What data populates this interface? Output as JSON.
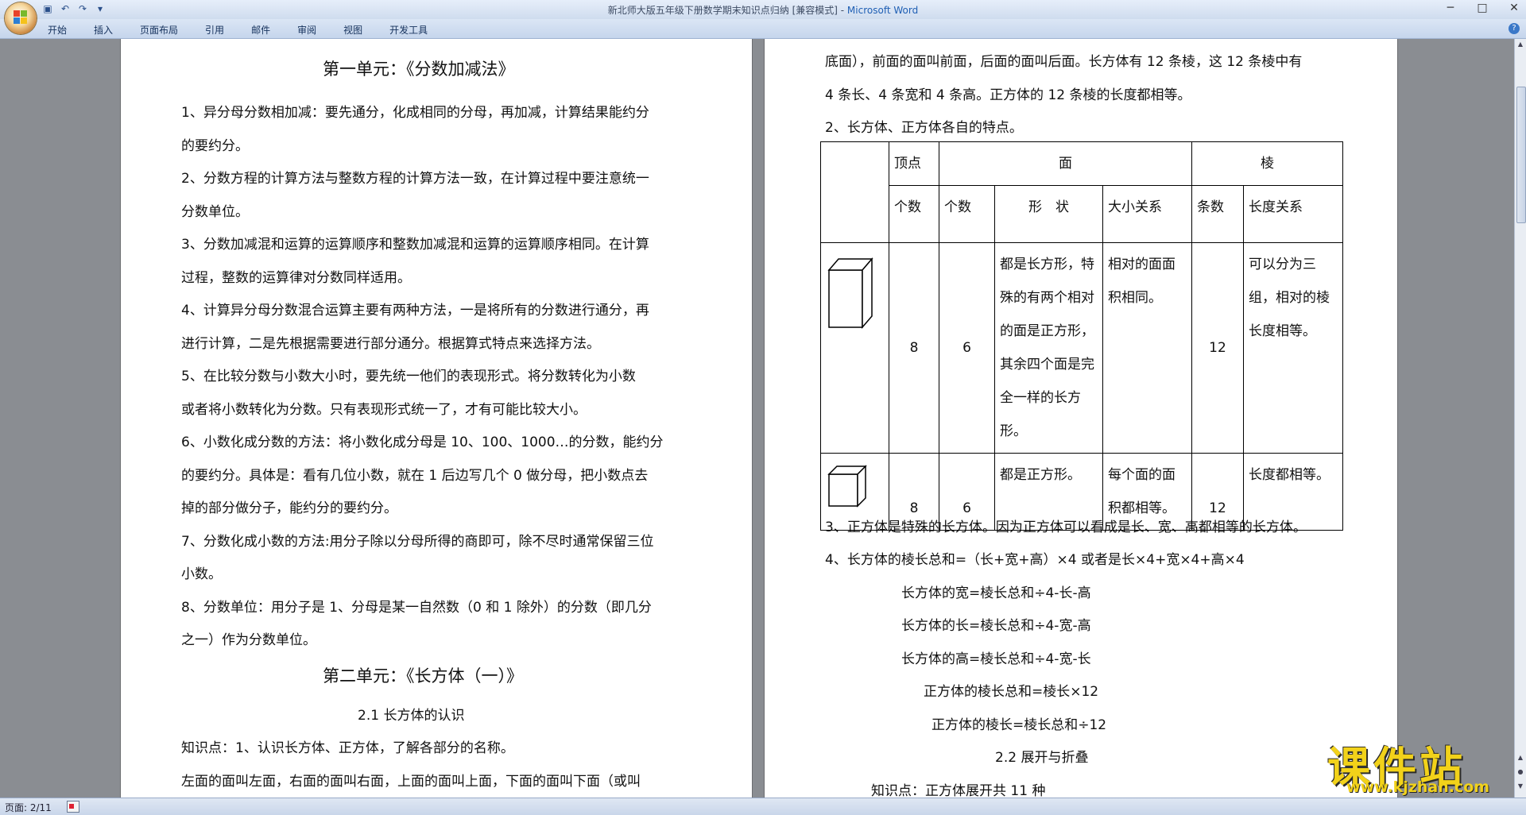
{
  "window": {
    "title": "新北师大版五年级下册数学期末知识点归纳 [兼容模式] - ",
    "app_name": "Microsoft Word",
    "minimize": "─",
    "maximize": "□",
    "close": "✕"
  },
  "ribbon": {
    "tabs": [
      "开始",
      "插入",
      "页面布局",
      "引用",
      "邮件",
      "审阅",
      "视图",
      "开发工具"
    ],
    "help": "?"
  },
  "quick_access": [
    "save-icon",
    "undo-icon",
    "redo-icon",
    "customize-icon"
  ],
  "left_page": {
    "heading1": "第一单元：《分数加减法》",
    "lines": [
      "1、异分母分数相加减：要先通分，化成相同的分母，再加减，计算结果能约分",
      "的要约分。",
      "2、分数方程的计算方法与整数方程的计算方法一致，在计算过程中要注意统一",
      "分数单位。",
      "3、分数加减混和运算的运算顺序和整数加减混和运算的运算顺序相同。在计算",
      "过程，整数的运算律对分数同样适用。",
      "4、计算异分母分数混合运算主要有两种方法，一是将所有的分数进行通分，再",
      "进行计算，二是先根据需要进行部分通分。根据算式特点来选择方法。",
      " 5、在比较分数与小数大小时，要先统一他们的表现形式。将分数转化为小数",
      "或者将小数转化为分数。只有表现形式统一了，才有可能比较大小。",
      "6、小数化成分数的方法：将小数化成分母是 10、100、1000…的分数，能约分",
      "的要约分。具体是：看有几位小数，就在 1 后边写几个 0 做分母，把小数点去",
      "掉的部分做分子，能约分的要约分。",
      "7、分数化成小数的方法:用分子除以分母所得的商即可，除不尽时通常保留三位",
      "小数。",
      "8、分数单位：用分子是 1、分母是某一自然数（0 和 1 除外）的分数（即几分",
      "之一）作为分数单位。"
    ],
    "heading2": "第二单元：《长方体（一）》",
    "subheading": "2.1 长方体的认识",
    "knowledge": "知识点：1、认识长方体、正方体，了解各部分的名称。",
    "last_line": "左面的面叫左面，右面的面叫右面，上面的面叫上面，下面的面叫下面（或叫"
  },
  "right_page": {
    "lines_top": [
      "底面），前面的面叫前面，后面的面叫后面。长方体有 12 条棱，这 12 条棱中有",
      "4 条长、4 条宽和 4 条高。正方体的 12 条棱的长度都相等。",
      "2、长方体、正方体各自的特点。"
    ],
    "table": {
      "header_vertex": "顶点",
      "header_face": "面",
      "header_edge": "棱",
      "sub_count_vertex": "个数",
      "sub_count_face": "个数",
      "sub_shape": "形　状",
      "sub_size": "大小关系",
      "sub_edge_count": "条数",
      "sub_edge_length": "长度关系",
      "cuboid": {
        "vertices": "8",
        "faces": "6",
        "shape": "都是长方形，特殊的有两个相对的面是正方形，其余四个面是完全一样的长方形。",
        "size": "相对的面面积相同。",
        "edges": "12",
        "length": "可以分为三组，相对的棱长度相等。"
      },
      "cube": {
        "vertices": "8",
        "faces": "6",
        "shape": "都是正方形。",
        "size": "每个面的面积都相等。",
        "edges": "12",
        "length": "长度都相等。"
      }
    },
    "lines_bottom": [
      "3、正方体是特殊的长方体。因为正方体可以看成是长、宽、高都相等的长方体。",
      "4、长方体的棱长总和=（长+宽+高）×4 或者是长×4+宽×4+高×4",
      "长方体的宽=棱长总和÷4-长-高",
      "长方体的长=棱长总和÷4-宽-高",
      "长方体的高=棱长总和÷4-宽-长",
      "正方体的棱长总和=棱长×12",
      "正方体的棱长=棱长总和÷12",
      "2.2 展开与折叠",
      "知识点：正方体展开共 11 种"
    ]
  },
  "status_bar": {
    "page": "页面: 2/11"
  },
  "watermark": {
    "text": "课件站",
    "url": "www.kjzhan.com"
  }
}
